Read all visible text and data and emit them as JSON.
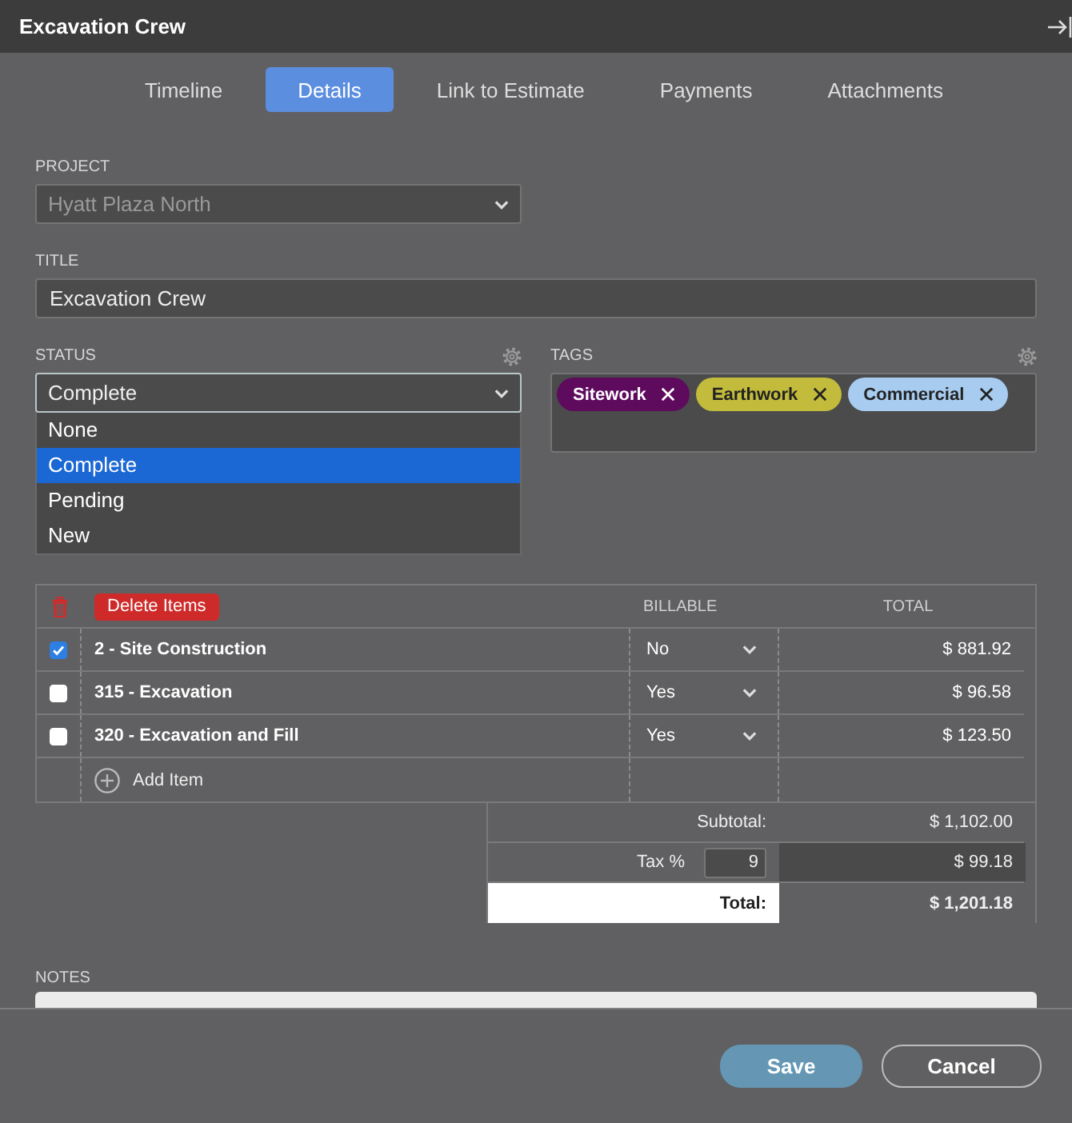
{
  "window": {
    "title": "Excavation Crew"
  },
  "tabs": [
    {
      "label": "Timeline",
      "selected": false
    },
    {
      "label": "Details",
      "selected": true
    },
    {
      "label": "Link to Estimate",
      "selected": false
    },
    {
      "label": "Payments",
      "selected": false
    },
    {
      "label": "Attachments",
      "selected": false
    }
  ],
  "project": {
    "label": "PROJECT",
    "value": "Hyatt Plaza North",
    "disabled": true
  },
  "title_field": {
    "label": "TITLE",
    "value": "Excavation Crew"
  },
  "status": {
    "label": "STATUS",
    "value": "Complete",
    "expanded": true,
    "options": [
      {
        "label": "None",
        "selected": false
      },
      {
        "label": "Complete",
        "selected": true
      },
      {
        "label": "Pending",
        "selected": false
      },
      {
        "label": "New",
        "selected": false
      }
    ]
  },
  "tags": {
    "label": "TAGS",
    "items": [
      {
        "label": "Sitework",
        "color": "#5e0b5e"
      },
      {
        "label": "Earthwork",
        "color": "#c2bb3b"
      },
      {
        "label": "Commercial",
        "color": "#a7ccf0"
      }
    ]
  },
  "items": {
    "delete_button": "Delete Items",
    "columns": [
      "BILLABLE",
      "TOTAL"
    ],
    "rows": [
      {
        "name": "2 - Site Construction",
        "checked": true,
        "billable": "No",
        "total": "$ 881.92"
      },
      {
        "name": "315 - Excavation",
        "checked": false,
        "billable": "Yes",
        "total": "$ 96.58"
      },
      {
        "name": "320 - Excavation and Fill",
        "checked": false,
        "billable": "Yes",
        "total": "$ 123.50"
      }
    ],
    "add_item": "Add Item"
  },
  "summary": {
    "subtotal_label": "Subtotal:",
    "subtotal": "$ 1,102.00",
    "tax_label": "Tax %",
    "tax_rate": "9",
    "tax": "$ 99.18",
    "total_label": "Total:",
    "total": "$ 1,201.18"
  },
  "notes": {
    "label": "NOTES"
  },
  "buttons": [
    {
      "label": "Save",
      "kind": "primary"
    },
    {
      "label": "Cancel",
      "kind": "secondary"
    }
  ]
}
